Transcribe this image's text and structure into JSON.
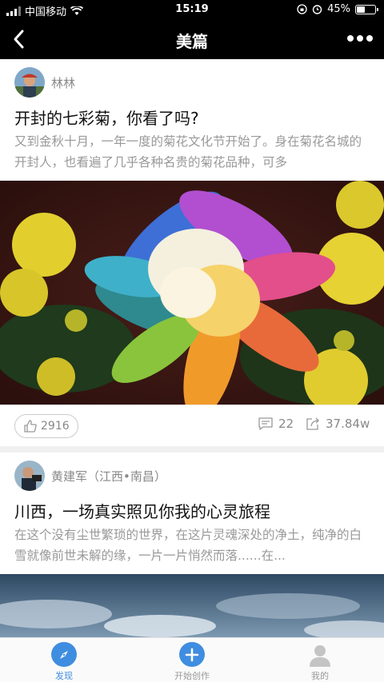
{
  "status_bar": {
    "carrier": "中国移动",
    "time": "15:19",
    "battery": "45%",
    "battery_level": 0.45
  },
  "nav": {
    "title": "美篇"
  },
  "articles": [
    {
      "author": "林林",
      "title": "开封的七彩菊，你看了吗?",
      "excerpt": "又到金秋十月，一年一度的菊花文化节开始了。身在菊花名城的开封人，也看遍了几乎各种名贵的菊花品种，可多",
      "likes": "2916",
      "comments": "22",
      "shares": "37.84w"
    },
    {
      "author": "黄建军（江西•南昌）",
      "title": "川西，一场真实照见你我的心灵旅程",
      "excerpt": "在这个没有尘世繁琐的世界，在这片灵魂深处的净土，纯净的白雪就像前世未解的缘，一片一片悄然而落......在..."
    }
  ],
  "tabbar": [
    {
      "label": "发现",
      "icon": "compass-icon",
      "active": true
    },
    {
      "label": "开始创作",
      "icon": "plus-icon",
      "active": false
    },
    {
      "label": "我的",
      "icon": "user-icon",
      "active": false
    }
  ],
  "colors": {
    "accent": "#3f8de0",
    "navbar": "#000000",
    "muted": "#999999"
  }
}
